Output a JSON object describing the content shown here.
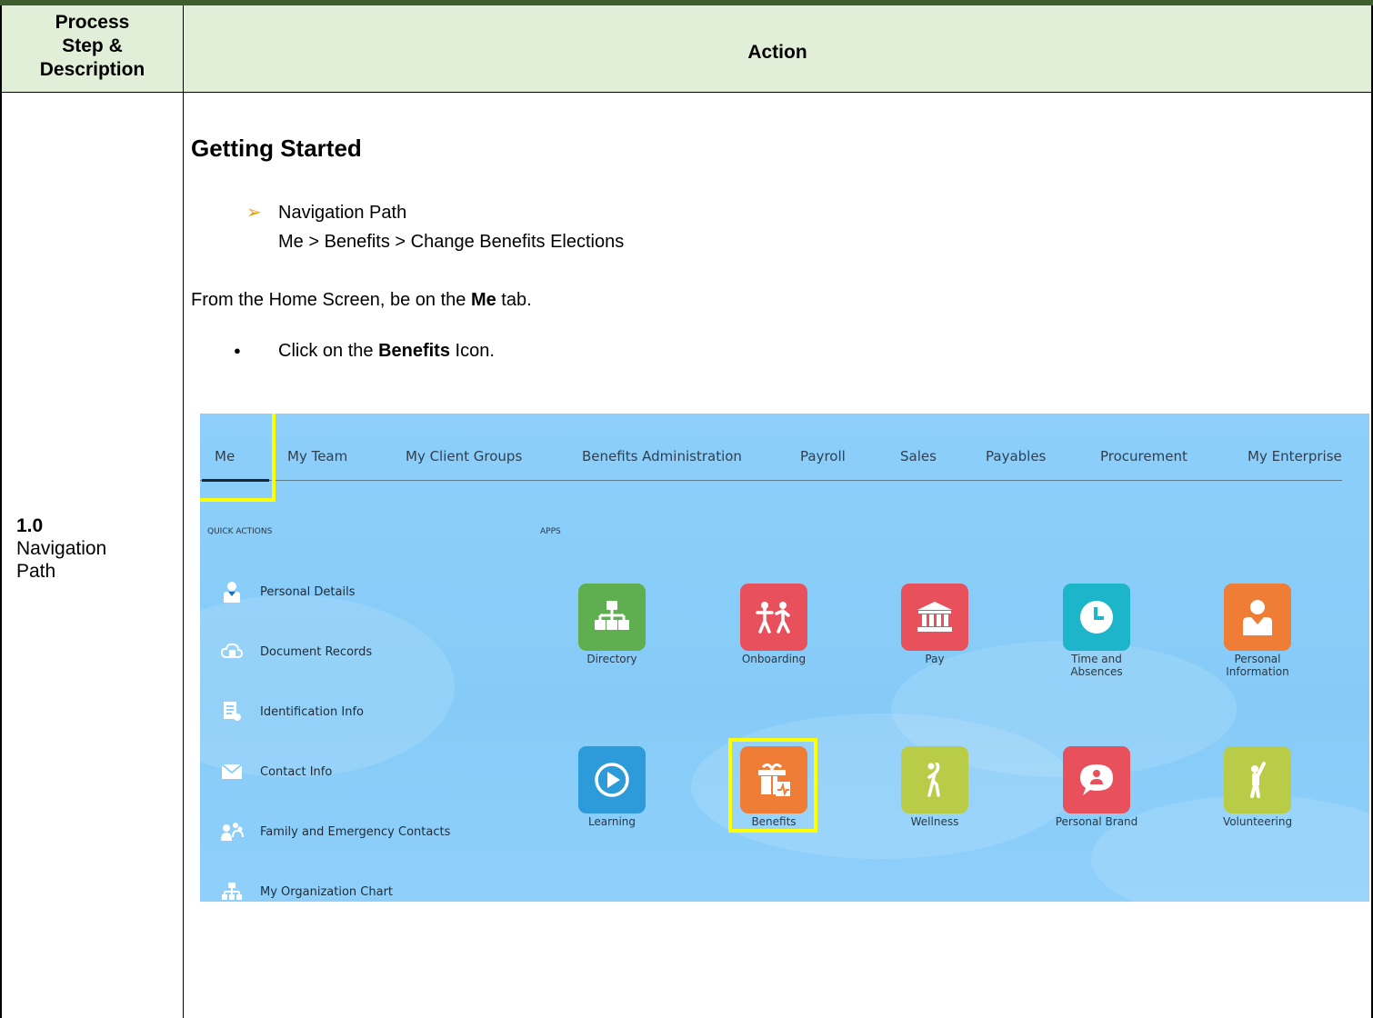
{
  "header": {
    "col1_line1": "Process",
    "col1_line2": "Step &",
    "col1_line3": "Description",
    "col2": "Action"
  },
  "step": {
    "number": "1.0",
    "name_line1": "Navigation",
    "name_line2": "Path"
  },
  "content": {
    "section_title": "Getting Started",
    "nav_title": "Navigation Path",
    "nav_path": "Me > Benefits > Change Benefits Elections",
    "home_pre": "From the Home Screen, be on the ",
    "home_bold": "Me",
    "home_post": " tab.",
    "click_pre": "Click on the ",
    "click_bold": "Benefits",
    "click_post": " Icon."
  },
  "screenshot": {
    "tabs": [
      "Me",
      "My Team",
      "My Client Groups",
      "Benefits Administration",
      "Payroll",
      "Sales",
      "Payables",
      "Procurement",
      "My Enterprise"
    ],
    "quick_actions_heading": "QUICK ACTIONS",
    "apps_heading": "APPS",
    "quick_actions": [
      "Personal Details",
      "Document Records",
      "Identification Info",
      "Contact Info",
      "Family and Emergency Contacts",
      "My Organization Chart"
    ],
    "apps_row1": [
      {
        "label": "Directory",
        "color": "#5fae4f",
        "icon": "org-chart-icon"
      },
      {
        "label": "Onboarding",
        "color": "#e8505b",
        "icon": "onboarding-icon"
      },
      {
        "label": "Pay",
        "color": "#e8505b",
        "icon": "bank-icon"
      },
      {
        "label": "Time and Absences",
        "color": "#1db5c9",
        "icon": "clock-icon"
      },
      {
        "label": "Personal Information",
        "color": "#ef7d35",
        "icon": "person-icon"
      }
    ],
    "apps_row2": [
      {
        "label": "Learning",
        "color": "#2d9ad9",
        "icon": "play-icon"
      },
      {
        "label": "Benefits",
        "color": "#ef7d35",
        "icon": "gift-icon"
      },
      {
        "label": "Wellness",
        "color": "#b8cc47",
        "icon": "stretch-icon"
      },
      {
        "label": "Personal Brand",
        "color": "#e8505b",
        "icon": "speech-person-icon"
      },
      {
        "label": "Volunteering",
        "color": "#b8cc47",
        "icon": "hand-raise-icon"
      }
    ],
    "highlight_color": "#ffff00"
  }
}
